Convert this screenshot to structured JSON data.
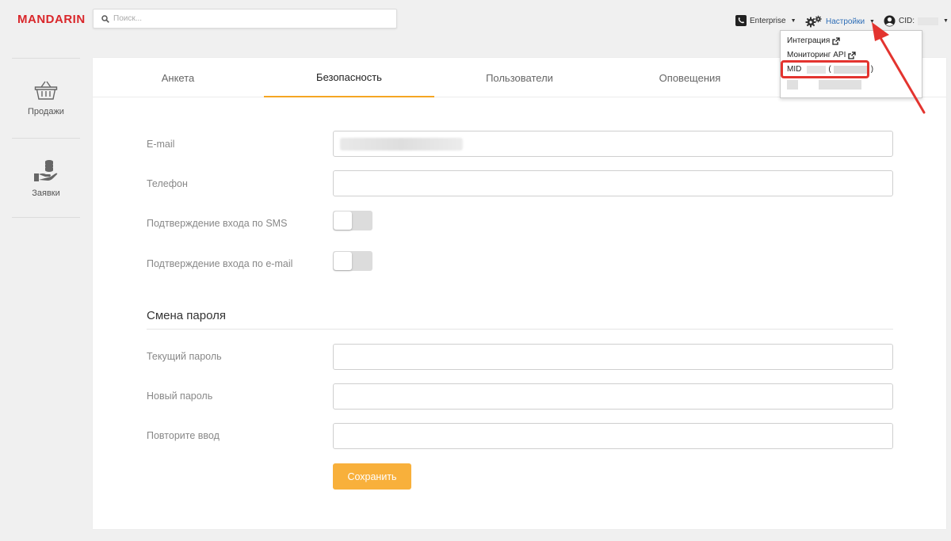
{
  "brand": {
    "logo_text": "MANDARIN"
  },
  "search": {
    "placeholder": "Поиск..."
  },
  "topbar": {
    "enterprise_label": "Enterprise",
    "settings_label": "Настройки",
    "cid_label": "CID:"
  },
  "settings_menu": {
    "items": [
      {
        "label": "Интеграция"
      },
      {
        "label": "Мониторинг API"
      },
      {
        "label": "MID",
        "suffix_open": "(",
        "suffix_close": ")"
      }
    ]
  },
  "sidebar": {
    "items": [
      {
        "label": "Продажи",
        "icon": "basket-icon"
      },
      {
        "label": "Заявки",
        "icon": "hand-coins-icon"
      }
    ]
  },
  "tabs": [
    {
      "label": "Анкета",
      "active": false
    },
    {
      "label": "Безопасность",
      "active": true
    },
    {
      "label": "Пользователи",
      "active": false
    },
    {
      "label": "Оповещения",
      "active": false
    }
  ],
  "security_form": {
    "email_label": "E-mail",
    "phone_label": "Телефон",
    "sms_confirm_label": "Подтверждение входа по SMS",
    "email_confirm_label": "Подтверждение входа по e-mail",
    "sms_confirm_on": false,
    "email_confirm_on": false
  },
  "password_section": {
    "title": "Смена пароля",
    "current_label": "Текущий пароль",
    "new_label": "Новый пароль",
    "repeat_label": "Повторите ввод",
    "save_label": "Сохранить"
  },
  "colors": {
    "brand_red": "#d9262a",
    "accent_orange": "#f8b03b",
    "link_blue": "#2d6db6",
    "annotation_red": "#e3342f"
  }
}
